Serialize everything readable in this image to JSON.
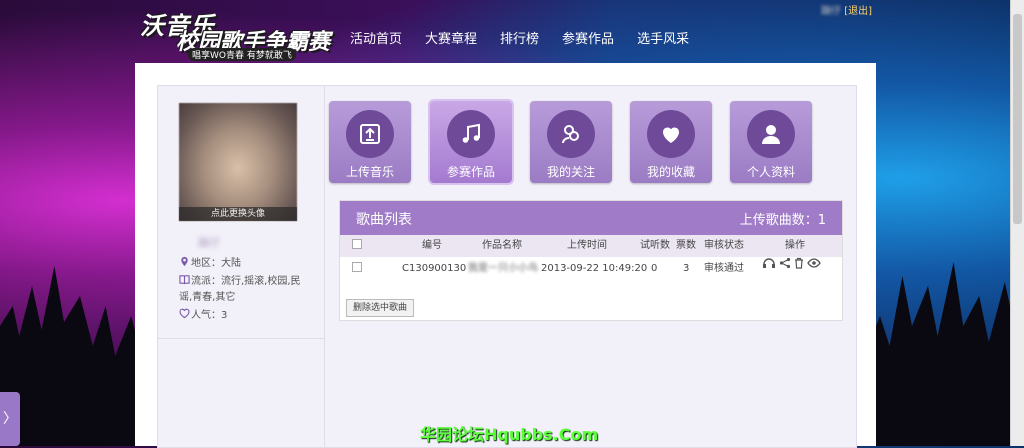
{
  "logo": {
    "line1": "沃音乐",
    "line2": "校园歌手争霸赛",
    "slogan": "唱享WO青春 有梦就敢飞"
  },
  "nav": [
    "活动首页",
    "大赛章程",
    "排行榜",
    "参赛作品",
    "选手风采"
  ],
  "user": {
    "name": "蹦仔",
    "logout": "[退出]"
  },
  "profile": {
    "avatar_caption": "点此更换头像",
    "name": "蹦仔",
    "region": "地区：大陆",
    "genre": "流派：流行,摇滚,校园,民谣,青春,其它",
    "popularity": "人气：3"
  },
  "tiles": [
    {
      "label": "上传音乐",
      "icon": "upload-icon"
    },
    {
      "label": "参赛作品",
      "icon": "music-note-icon",
      "active": true
    },
    {
      "label": "我的关注",
      "icon": "follow-icon"
    },
    {
      "label": "我的收藏",
      "icon": "heart-icon"
    },
    {
      "label": "个人资料",
      "icon": "person-icon"
    }
  ],
  "songs": {
    "title": "歌曲列表",
    "count_label": "上传歌曲数：1",
    "columns": [
      "编号",
      "作品名称",
      "上传时间",
      "试听数",
      "票数",
      "审核状态",
      "操作"
    ],
    "rows": [
      {
        "id": "C130900130",
        "name": "我是一只小小鸟",
        "upload_time": "2013-09-22 10:49:20",
        "plays": "0",
        "votes": "3",
        "status": "审核通过"
      }
    ],
    "delete_label": "删除选中歌曲"
  },
  "side_tab": "〉",
  "watermark": "华园论坛Hqubbs.Com",
  "colors": {
    "accent": "#a07cc8",
    "tile": "#9b7cc4",
    "tile_circle": "#6e4a98"
  }
}
